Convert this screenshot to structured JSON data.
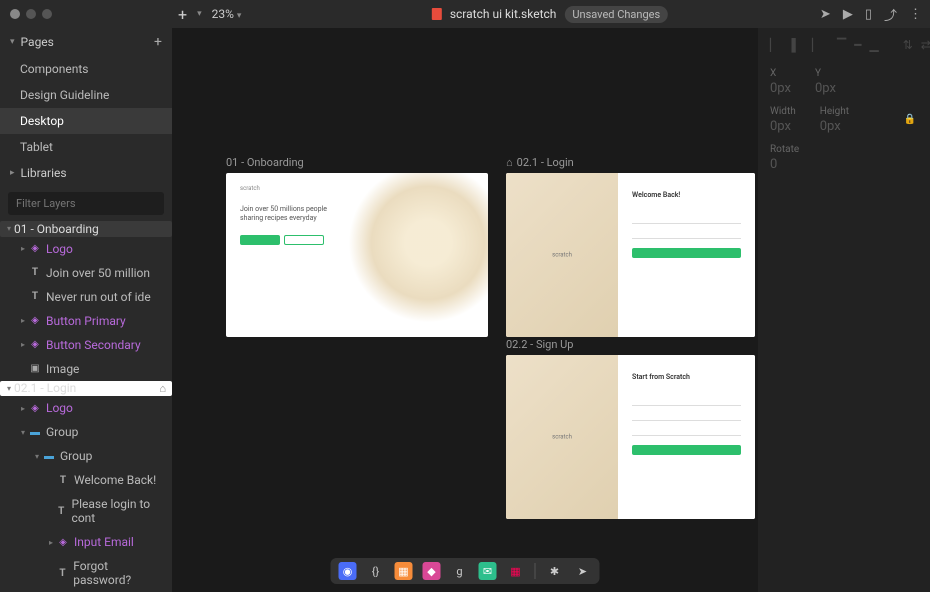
{
  "titlebar": {
    "filename": "scratch ui kit.sketch",
    "status_badge": "Unsaved Changes",
    "zoom": "23%"
  },
  "sidebar": {
    "pages_label": "Pages",
    "libraries_label": "Libraries",
    "filter_placeholder": "Filter Layers",
    "pages": [
      {
        "name": "Components",
        "active": false
      },
      {
        "name": "Design Guideline",
        "active": false
      },
      {
        "name": "Desktop",
        "active": true
      },
      {
        "name": "Tablet",
        "active": false
      }
    ],
    "layers": [
      {
        "name": "01 - Onboarding",
        "type": "artboard",
        "indent": 1,
        "expanded": true,
        "selected": true
      },
      {
        "name": "Logo",
        "type": "symbol",
        "indent": 2,
        "purple": true
      },
      {
        "name": "Join over 50 million",
        "type": "text",
        "indent": 2
      },
      {
        "name": "Never run out of ide",
        "type": "text",
        "indent": 2
      },
      {
        "name": "Button Primary",
        "type": "symbol",
        "indent": 2,
        "purple": true
      },
      {
        "name": "Button Secondary",
        "type": "symbol",
        "indent": 2,
        "purple": true
      },
      {
        "name": "Image",
        "type": "image",
        "indent": 2
      },
      {
        "name": "02.1 - Login",
        "type": "artboard",
        "indent": 1,
        "expanded": true,
        "home": true
      },
      {
        "name": "Logo",
        "type": "symbol",
        "indent": 2,
        "purple": true
      },
      {
        "name": "Group",
        "type": "group",
        "indent": 2,
        "expanded": true
      },
      {
        "name": "Group",
        "type": "group",
        "indent": 3,
        "expanded": true
      },
      {
        "name": "Welcome Back!",
        "type": "text",
        "indent": 4
      },
      {
        "name": "Please login to cont",
        "type": "text",
        "indent": 4
      },
      {
        "name": "Input Email",
        "type": "symbol",
        "indent": 4,
        "purple": true
      },
      {
        "name": "Forgot password?",
        "type": "text",
        "indent": 4
      }
    ]
  },
  "canvas": {
    "artboard1_label": "01 - Onboarding",
    "artboard2_label": "02.1 - Login",
    "artboard3_label": "02.2 - Sign Up",
    "onboard": {
      "logo": "scratch",
      "heading": "Join over 50 millions people sharing recipes everyday"
    },
    "login": {
      "logo": "scratch",
      "title": "Welcome Back!"
    },
    "signup": {
      "logo": "scratch",
      "title": "Start from Scratch"
    }
  },
  "inspector": {
    "x_label": "X",
    "x_value": "0px",
    "y_label": "Y",
    "y_value": "0px",
    "w_label": "Width",
    "w_value": "0px",
    "h_label": "Height",
    "h_value": "0px",
    "r_label": "Rotate",
    "r_value": "0"
  },
  "dock": {
    "icons": [
      "anima",
      "code",
      "zeplin",
      "abstract",
      "g",
      "chat",
      "grid",
      "slack",
      "rocket"
    ]
  }
}
